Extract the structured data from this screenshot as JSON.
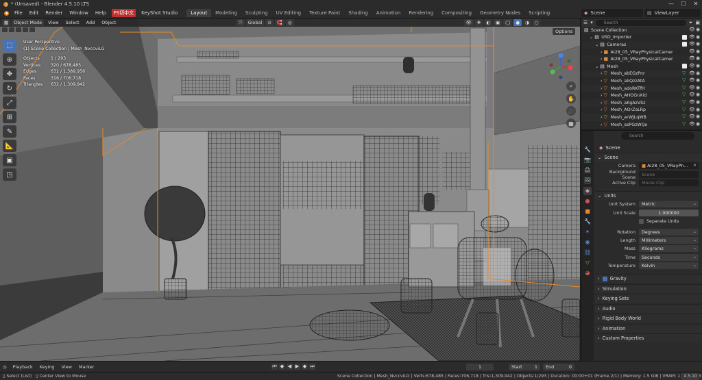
{
  "window": {
    "title": "* (Unsaved) - Blender 4.5.10 LTS",
    "minimize": "—",
    "maximize": "☐",
    "close": "✕"
  },
  "menubar": {
    "menus": [
      "File",
      "Edit",
      "Render",
      "Window",
      "Help"
    ],
    "fs_badge": "FS切中文",
    "keyshot": "KeyShot Studio",
    "workspaces": [
      "Layout",
      "Modeling",
      "Sculpting",
      "UV Editing",
      "Texture Paint",
      "Shading",
      "Animation",
      "Rendering",
      "Compositing",
      "Geometry Nodes",
      "Scripting"
    ],
    "active_workspace": "Layout",
    "scene": "Scene",
    "view_layer": "ViewLayer"
  },
  "viewport": {
    "mode": "Object Mode",
    "menus": [
      "View",
      "Select",
      "Add",
      "Object"
    ],
    "transform": "Global",
    "options": "Options",
    "perspective": "User Perspective",
    "collection_path": "(1) Scene Collection | Mesh_NvccviLG",
    "stats": [
      {
        "label": "Objects",
        "value": "1 / 293"
      },
      {
        "label": "Vertices",
        "value": "320 / 678,485"
      },
      {
        "label": "Edges",
        "value": "632 / 1,389,956"
      },
      {
        "label": "Faces",
        "value": "316 / 706,718"
      },
      {
        "label": "Triangles",
        "value": "632 / 1,309,942"
      }
    ]
  },
  "outliner": {
    "search_placeholder": "Search",
    "rows": [
      {
        "name": "Scene Collection",
        "indent": 0,
        "kind": "collection"
      },
      {
        "name": "USD_Importer",
        "indent": 1,
        "kind": "collection"
      },
      {
        "name": "Cameras",
        "indent": 2,
        "kind": "collection"
      },
      {
        "name": "AI28_05_VRayPhysicalCamer",
        "indent": 3,
        "kind": "camera"
      },
      {
        "name": "AI28_05_VRayPhysicalCamer",
        "indent": 3,
        "kind": "camera"
      },
      {
        "name": "Mesh",
        "indent": 2,
        "kind": "collection"
      },
      {
        "name": "Mesh_abEGzPnr",
        "indent": 3,
        "kind": "mesh"
      },
      {
        "name": "Mesh_abQzzAtA",
        "indent": 3,
        "kind": "mesh"
      },
      {
        "name": "Mesh_adoRKTfH",
        "indent": 3,
        "kind": "mesh"
      },
      {
        "name": "Mesh_AHOGnXid",
        "indent": 3,
        "kind": "mesh"
      },
      {
        "name": "Mesh_aKgAzVSz",
        "indent": 3,
        "kind": "mesh"
      },
      {
        "name": "Mesh_AOrZaLRp",
        "indent": 3,
        "kind": "mesh"
      },
      {
        "name": "Mesh_arWJLqWB",
        "indent": 3,
        "kind": "mesh"
      },
      {
        "name": "Mesh_asPGzWQo",
        "indent": 3,
        "kind": "mesh"
      }
    ]
  },
  "properties": {
    "search_placeholder": "Search",
    "context": "Scene",
    "scene_panel": {
      "title": "Scene",
      "camera_label": "Camera",
      "camera_value": "AI28_05_VRayPh...",
      "bg_label": "Background Scene",
      "bg_placeholder": "Scene",
      "clip_label": "Active Clip",
      "clip_placeholder": "Movie Clip"
    },
    "units_panel": {
      "title": "Units",
      "unit_system_label": "Unit System",
      "unit_system": "Metric",
      "unit_scale_label": "Unit Scale",
      "unit_scale": "1.000000",
      "separate_units": "Separate Units",
      "rotation_label": "Rotation",
      "rotation": "Degrees",
      "length_label": "Length",
      "length": "Millimeters",
      "mass_label": "Mass",
      "mass": "Kilograms",
      "time_label": "Time",
      "time": "Seconds",
      "temperature_label": "Temperature",
      "temperature": "Kelvin"
    },
    "collapsed_panels": [
      "Gravity",
      "Simulation",
      "Keying Sets",
      "Audio",
      "Rigid Body World",
      "Animation",
      "Custom Properties"
    ]
  },
  "timeline": {
    "menus": [
      "Playback",
      "Keying",
      "View",
      "Marker"
    ],
    "current_frame": "1",
    "start_label": "Start",
    "start": "1",
    "end_label": "End",
    "end": "0"
  },
  "statusbar": {
    "select": "Select (List)",
    "center": "Center View to Mouse",
    "info": "Scene Collection | Mesh_NvccviLG | Verts:678,485 | Faces:706,718 | Tris:1,309,942 | Objects:1/293 | Duration: 00:00+01 (Frame 2/1) | Memory: 1.5 GiB | VRAM: 1.9/4.0 GiB",
    "version": "4.5.10"
  },
  "colors": {
    "accent": "#4772b3",
    "selection_outline": "#e8892b",
    "mesh_icon": "#5fb85f",
    "camera_icon": "#e08a3b"
  }
}
